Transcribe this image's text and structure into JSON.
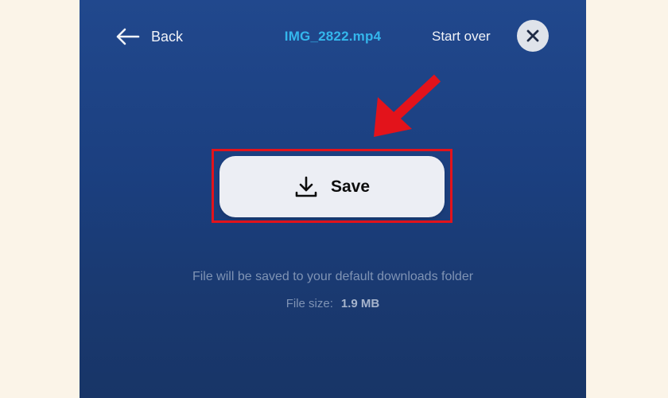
{
  "header": {
    "back_label": "Back",
    "file_name": "IMG_2822.mp4",
    "start_over_label": "Start over"
  },
  "main": {
    "save_label": "Save",
    "note": "File will be saved to your default downloads folder",
    "file_size_label": "File size:",
    "file_size_value": "1.9 MB"
  },
  "icons": {
    "back": "arrow-left-icon",
    "close": "close-icon",
    "save": "download-icon",
    "annotation": "red-arrow-pointer"
  },
  "colors": {
    "background": "#fbf4e8",
    "panel_top": "#21488d",
    "panel_bottom": "#183567",
    "file_name": "#34b6ec",
    "button_bg": "#eceef4",
    "highlight": "#e3131b",
    "muted_text": "#7f93b4"
  }
}
